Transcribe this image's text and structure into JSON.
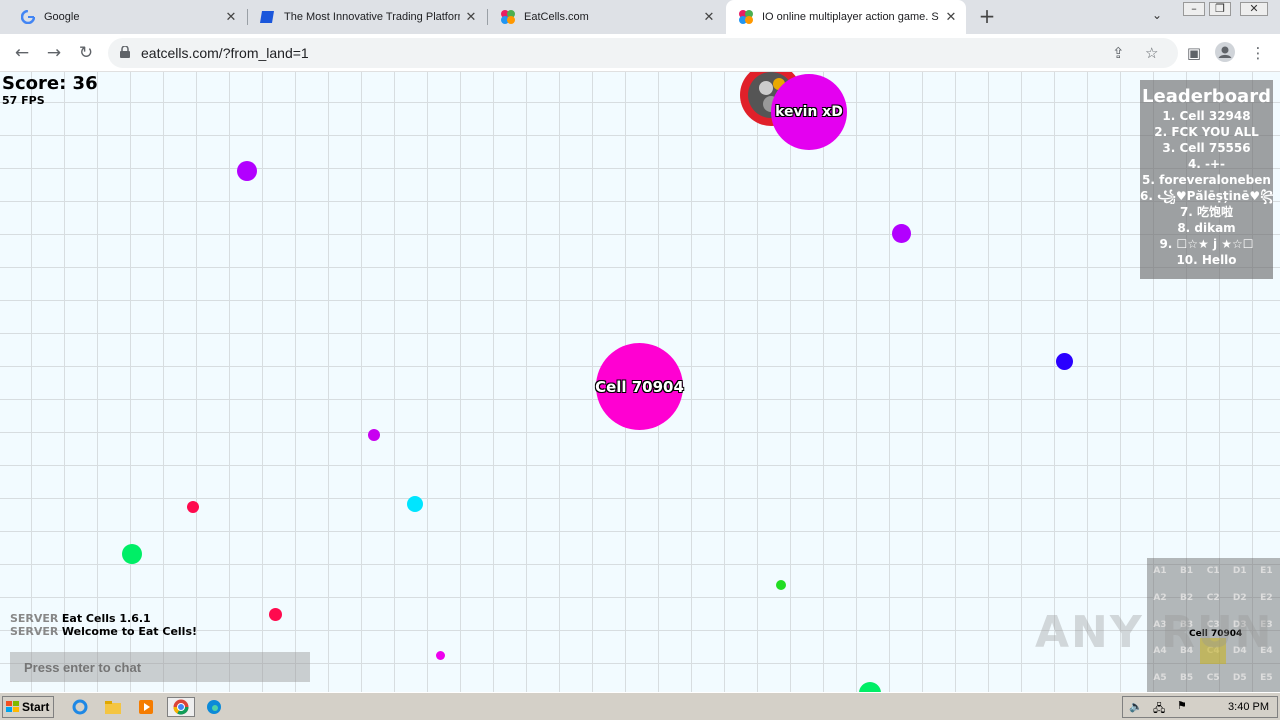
{
  "browser": {
    "tabs": [
      {
        "title": "Google",
        "close": "✕"
      },
      {
        "title": "The Most Innovative Trading Platform",
        "close": "✕"
      },
      {
        "title": "EatCells.com",
        "close": "✕"
      },
      {
        "title": "IO online multiplayer action game. S",
        "close": "✕"
      }
    ],
    "new_tab": "+",
    "url": "eatcells.com/?from_land=1"
  },
  "game": {
    "score_label": "Score: 36",
    "fps_label": "57 FPS",
    "player_cell": {
      "name": "Cell 70904",
      "color": "#ff00d2"
    },
    "enemy_cell": {
      "name": "kevin xD",
      "color": "#e400f0"
    },
    "pellet_colors": [
      "#b200ff",
      "#b200ff",
      "#2a00ff",
      "#c800f0",
      "#00e5ff",
      "#ff0a4e",
      "#00ee66",
      "#ff0a4e",
      "#22dd22",
      "#ee00ee",
      "#00ee66"
    ]
  },
  "leaderboard": {
    "title": "Leaderboard",
    "entries": [
      "1. Cell 32948",
      "2. FCK YOU ALL",
      "3. Cell 75556",
      "4. -+-",
      "5. foreveraloneben",
      "6. ꧁♥Pălēṣținē♥꧂",
      "7. 吃饱啦",
      "8. dikam",
      "9. ☐☆★ j ★☆☐",
      "10. Hello"
    ]
  },
  "chat": {
    "messages": [
      {
        "from": "SERVER",
        "text": "Eat Cells 1.6.1"
      },
      {
        "from": "SERVER",
        "text": "Welcome to Eat Cells!"
      }
    ],
    "placeholder": "Press enter to chat"
  },
  "minimap": {
    "rows": [
      [
        "A1",
        "B1",
        "C1",
        "D1",
        "E1"
      ],
      [
        "A2",
        "B2",
        "C2",
        "D2",
        "E2"
      ],
      [
        "A3",
        "B3",
        "C3",
        "D3",
        "E3"
      ],
      [
        "A4",
        "B4",
        "C4",
        "D4",
        "E4"
      ],
      [
        "A5",
        "B5",
        "C5",
        "D5",
        "E5"
      ]
    ],
    "player_label": "Cell 70904",
    "watermark": "ANY RUN"
  },
  "taskbar": {
    "start_label": "Start",
    "clock": "3:40 PM"
  }
}
